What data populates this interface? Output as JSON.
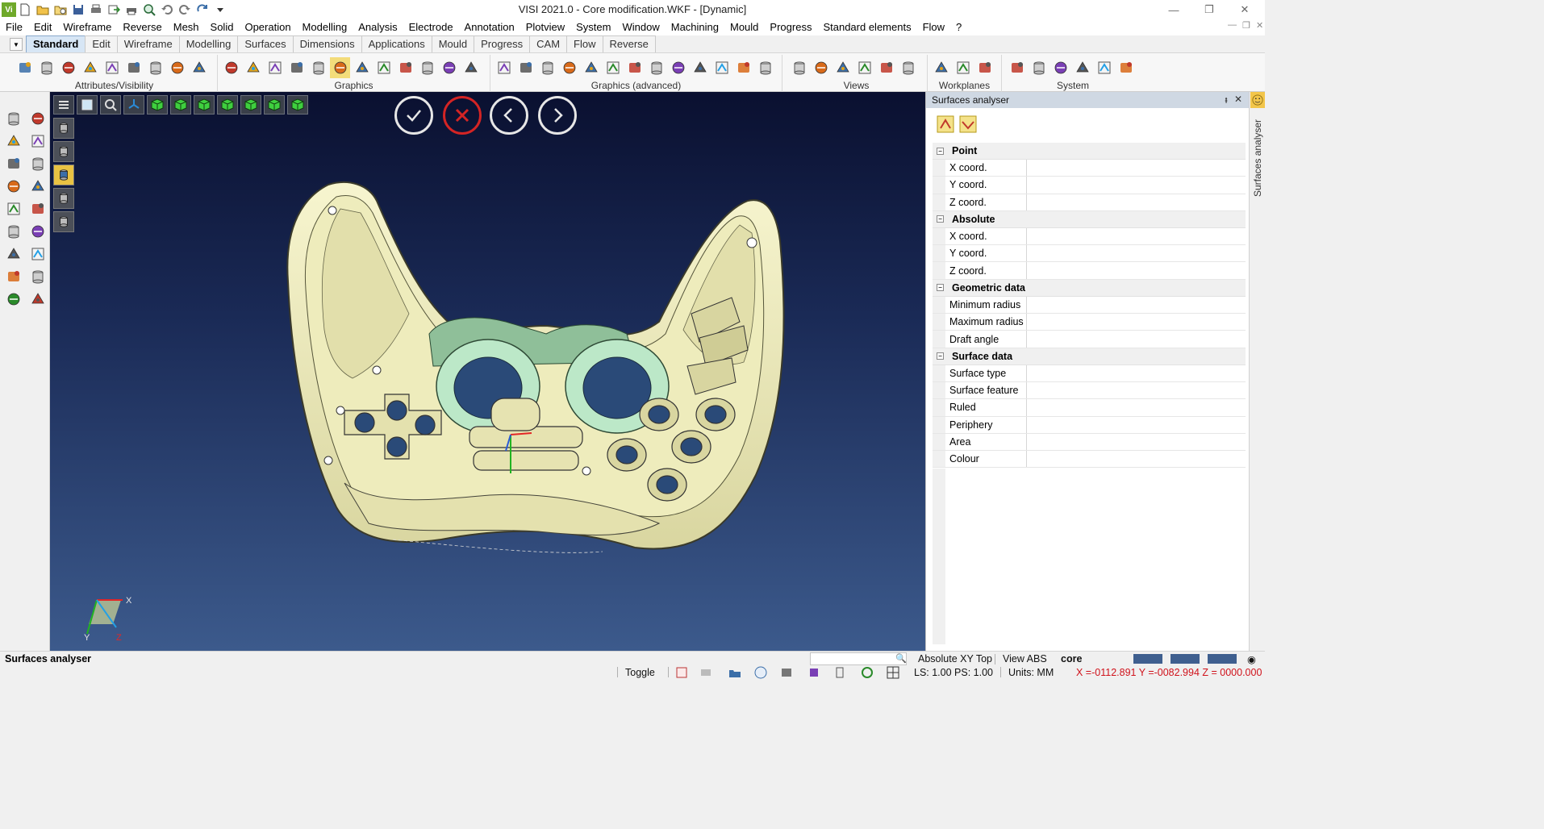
{
  "app": {
    "logo": "Vi",
    "window_title": "VISI 2021.0  - Core modification.WKF - [Dynamic]",
    "quick_access": [
      "new-file-icon",
      "open-folder-icon",
      "open-recent-icon",
      "save-icon",
      "print-setup-icon",
      "export-icon",
      "print-icon",
      "zoom-preview-icon",
      "undo-icon",
      "redo-icon",
      "repeat-icon",
      "customize-dropdown-icon"
    ]
  },
  "menubar": {
    "items": [
      "File",
      "Edit",
      "Wireframe",
      "Reverse",
      "Mesh",
      "Solid",
      "Operation",
      "Modelling",
      "Analysis",
      "Electrode",
      "Annotation",
      "Plotview",
      "System",
      "Window",
      "Machining",
      "Mould",
      "Progress",
      "Standard elements",
      "Flow",
      "?"
    ]
  },
  "ribbon": {
    "tabs": [
      "Standard",
      "Edit",
      "Wireframe",
      "Modelling",
      "Surfaces",
      "Dimensions",
      "Applications",
      "Mould",
      "Progress",
      "CAM",
      "Flow",
      "Reverse"
    ],
    "active_tab": "Standard",
    "groups": [
      {
        "label": "Attributes/Visibility",
        "icons": [
          "attributes-icon",
          "layer-icon",
          "hide-icon",
          "show-icon",
          "colour-icon",
          "swap-icon",
          "filter-icon",
          "reveal-icon",
          "visibility-icon"
        ]
      },
      {
        "label": "Graphics",
        "icons": [
          "regenerate-icon",
          "wire-shade-icon",
          "hidden-line-icon",
          "shaded-icon",
          "shaded-edges-icon",
          "shaded-selected-icon",
          "transparent-icon",
          "wireframe-icon",
          "section-icon",
          "render-icon",
          "materials-icon",
          "clipping-icon"
        ]
      },
      {
        "label": "Graphics (advanced)",
        "icons": [
          "perspective-icon",
          "light-icon",
          "environment-icon",
          "sketch-icon",
          "cylinder-icon",
          "cylinder-alt-icon",
          "surface-shade-icon",
          "analysis-shade-icon",
          "mesh-icon",
          "cube-icon",
          "sphere-icon",
          "colour-map-icon",
          "sphere-shade-icon"
        ]
      },
      {
        "label": "Views",
        "icons": [
          "zoom-icon",
          "zoom-extents-icon",
          "zoom-window-icon",
          "pan-icon",
          "rotate-icon",
          "view-user-icon"
        ]
      },
      {
        "label": "Workplanes",
        "icons": [
          "workplane-icon",
          "workplane-align-icon",
          "workplane-dynamic-icon"
        ]
      },
      {
        "label": "System",
        "icons": [
          "palette-icon",
          "settings-icon",
          "options-icon",
          "image-icon",
          "grid-icon",
          "plane-icon"
        ]
      }
    ]
  },
  "left_toolbar": {
    "icons": [
      "measure-icon",
      "snap-icon",
      "box-icon",
      "edit-point-icon",
      "transform-icon",
      "check-icon",
      "curve-tool-icon",
      "modify-icon",
      "layers-tool-icon",
      "surface-tool-icon",
      "refresh-tool-icon",
      "solid-tool-icon",
      "help-tool-icon",
      "dimension-tool-icon",
      "trash-tool-icon",
      "undo-tool-icon",
      "settings-tool-icon",
      "folder-tool-icon"
    ]
  },
  "viewport": {
    "top_toolbar": [
      "menu-icon",
      "fit-icon",
      "zoom-search-icon",
      "axis-icon",
      "view-top-icon",
      "view-front-icon",
      "view-right-icon",
      "view-iso-icon",
      "view-left-icon",
      "view-back-icon",
      "view-bottom-icon"
    ],
    "side_toolbar": [
      "cylinder-mode-1-icon",
      "cylinder-mode-2-icon",
      "cylinder-mode-3-icon",
      "cylinder-mode-4-icon",
      "cylinder-mode-5-icon"
    ],
    "nav": [
      "confirm-icon",
      "cancel-icon",
      "previous-icon",
      "next-icon"
    ],
    "axis_labels": {
      "x": "X",
      "y": "Y",
      "z": "Z"
    }
  },
  "panel": {
    "title": "Surfaces analyser",
    "pin": "⭻",
    "close": "✕",
    "tools": [
      "select-surface-icon",
      "analyse-surface-icon"
    ],
    "sections": [
      {
        "title": "Point",
        "rows": [
          {
            "name": "X coord.",
            "value": ""
          },
          {
            "name": "Y coord.",
            "value": ""
          },
          {
            "name": "Z coord.",
            "value": ""
          }
        ]
      },
      {
        "title": "Absolute",
        "rows": [
          {
            "name": "X coord.",
            "value": ""
          },
          {
            "name": "Y coord.",
            "value": ""
          },
          {
            "name": "Z coord.",
            "value": ""
          }
        ]
      },
      {
        "title": "Geometric data",
        "rows": [
          {
            "name": "Minimum radius",
            "value": ""
          },
          {
            "name": "Maximum radius",
            "value": ""
          },
          {
            "name": "Draft angle",
            "value": ""
          }
        ]
      },
      {
        "title": "Surface data",
        "rows": [
          {
            "name": "Surface type",
            "value": ""
          },
          {
            "name": "Surface feature",
            "value": ""
          },
          {
            "name": "Ruled",
            "value": ""
          },
          {
            "name": "Periphery",
            "value": ""
          },
          {
            "name": "Area",
            "value": ""
          },
          {
            "name": "Colour",
            "value": ""
          }
        ]
      }
    ]
  },
  "side_strip": {
    "label": "Surfaces analyser"
  },
  "status": {
    "message": "Surfaces analyser",
    "cplane": "Absolute XY Top",
    "view": "View ABS",
    "layer": "core",
    "toggle": "Toggle",
    "ls_ps": "LS: 1.00 PS: 1.00",
    "units": "Units: MM",
    "coords": "X =-0112.891 Y =-0082.994 Z = 0000.000",
    "coords_color": "#d0121b"
  },
  "colors": {
    "accent": "#d7e6f5",
    "viewport_top": "#0a1030",
    "viewport_bottom": "#3c5a8c",
    "model": "#f4f2c4",
    "model_green": "#b9e3c8",
    "cancel": "#d42424"
  }
}
